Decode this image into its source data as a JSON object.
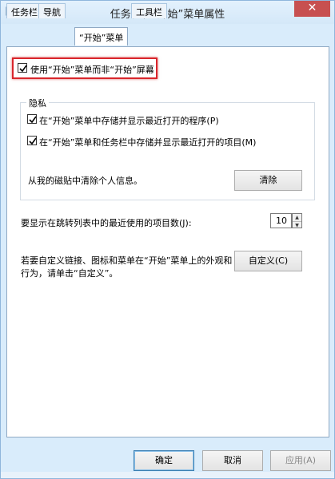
{
  "window": {
    "title": "任务栏和“开始”菜单属性",
    "close_label": "✕"
  },
  "tabs": [
    {
      "label": "任务栏",
      "active": false
    },
    {
      "label": "导航",
      "active": false
    },
    {
      "label": "“开始”菜单",
      "active": true
    },
    {
      "label": "工具栏",
      "active": false
    }
  ],
  "start_menu_option": {
    "label": "使用“开始”菜单而非“开始”屏幕",
    "checked": true
  },
  "privacy": {
    "title": "隐私",
    "store_programs": {
      "label": "在“开始”菜单中存储并显示最近打开的程序(P)",
      "checked": true
    },
    "store_items": {
      "label": "在“开始”菜单和任务栏中存储并显示最近打开的项目(M)",
      "checked": true
    },
    "clear_text": "从我的磁贴中清除个人信息。",
    "clear_button": "清除"
  },
  "jump_list": {
    "label": "要显示在跳转列表中的最近使用的项目数(J):",
    "value": "10"
  },
  "customize": {
    "text_line1": "若要自定义链接、图标和菜单在“开始”菜单上的外观和",
    "text_line2": "行为，请单击“自定义”。",
    "button": "自定义(C)"
  },
  "footer": {
    "ok": "确定",
    "cancel": "取消",
    "apply": "应用(A)"
  },
  "colors": {
    "highlight_border": "#d9262c",
    "window_bg": "#d9ecfb"
  }
}
